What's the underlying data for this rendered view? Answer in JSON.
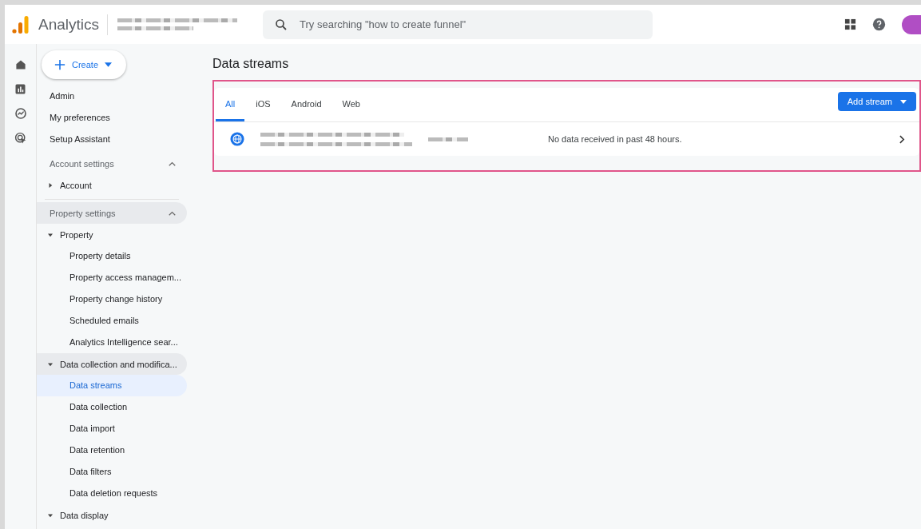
{
  "app": {
    "name": "Analytics"
  },
  "search": {
    "placeholder": "Try searching \"how to create funnel\""
  },
  "create_button": {
    "label": "Create"
  },
  "nav": [
    {
      "kind": "link",
      "label": "Admin"
    },
    {
      "kind": "link",
      "label": "My preferences"
    },
    {
      "kind": "link",
      "label": "Setup Assistant"
    },
    {
      "kind": "section",
      "label": "Account settings",
      "expanded": true,
      "highlighted": false,
      "children": [
        {
          "label": "Account",
          "expanded": false,
          "highlighted": false
        }
      ]
    },
    {
      "kind": "section",
      "label": "Property settings",
      "expanded": true,
      "highlighted": true,
      "children": [
        {
          "label": "Property",
          "expanded": true,
          "highlighted": false,
          "children": [
            {
              "label": "Property details",
              "selected": false
            },
            {
              "label": "Property access managem...",
              "selected": false
            },
            {
              "label": "Property change history",
              "selected": false
            },
            {
              "label": "Scheduled emails",
              "selected": false
            },
            {
              "label": "Analytics Intelligence sear...",
              "selected": false
            }
          ]
        },
        {
          "label": "Data collection and modifica...",
          "expanded": true,
          "highlighted": true,
          "children": [
            {
              "label": "Data streams",
              "selected": true
            },
            {
              "label": "Data collection",
              "selected": false
            },
            {
              "label": "Data import",
              "selected": false
            },
            {
              "label": "Data retention",
              "selected": false
            },
            {
              "label": "Data filters",
              "selected": false
            },
            {
              "label": "Data deletion requests",
              "selected": false
            }
          ]
        },
        {
          "label": "Data display",
          "expanded": true,
          "highlighted": false
        }
      ]
    }
  ],
  "page": {
    "title": "Data streams"
  },
  "tabs": [
    {
      "label": "All",
      "selected": true
    },
    {
      "label": "iOS",
      "selected": false
    },
    {
      "label": "Android",
      "selected": false
    },
    {
      "label": "Web",
      "selected": false
    }
  ],
  "add_button": {
    "label": "Add stream"
  },
  "streams": [
    {
      "kind": "web",
      "status": "No data received in past 48 hours."
    }
  ]
}
